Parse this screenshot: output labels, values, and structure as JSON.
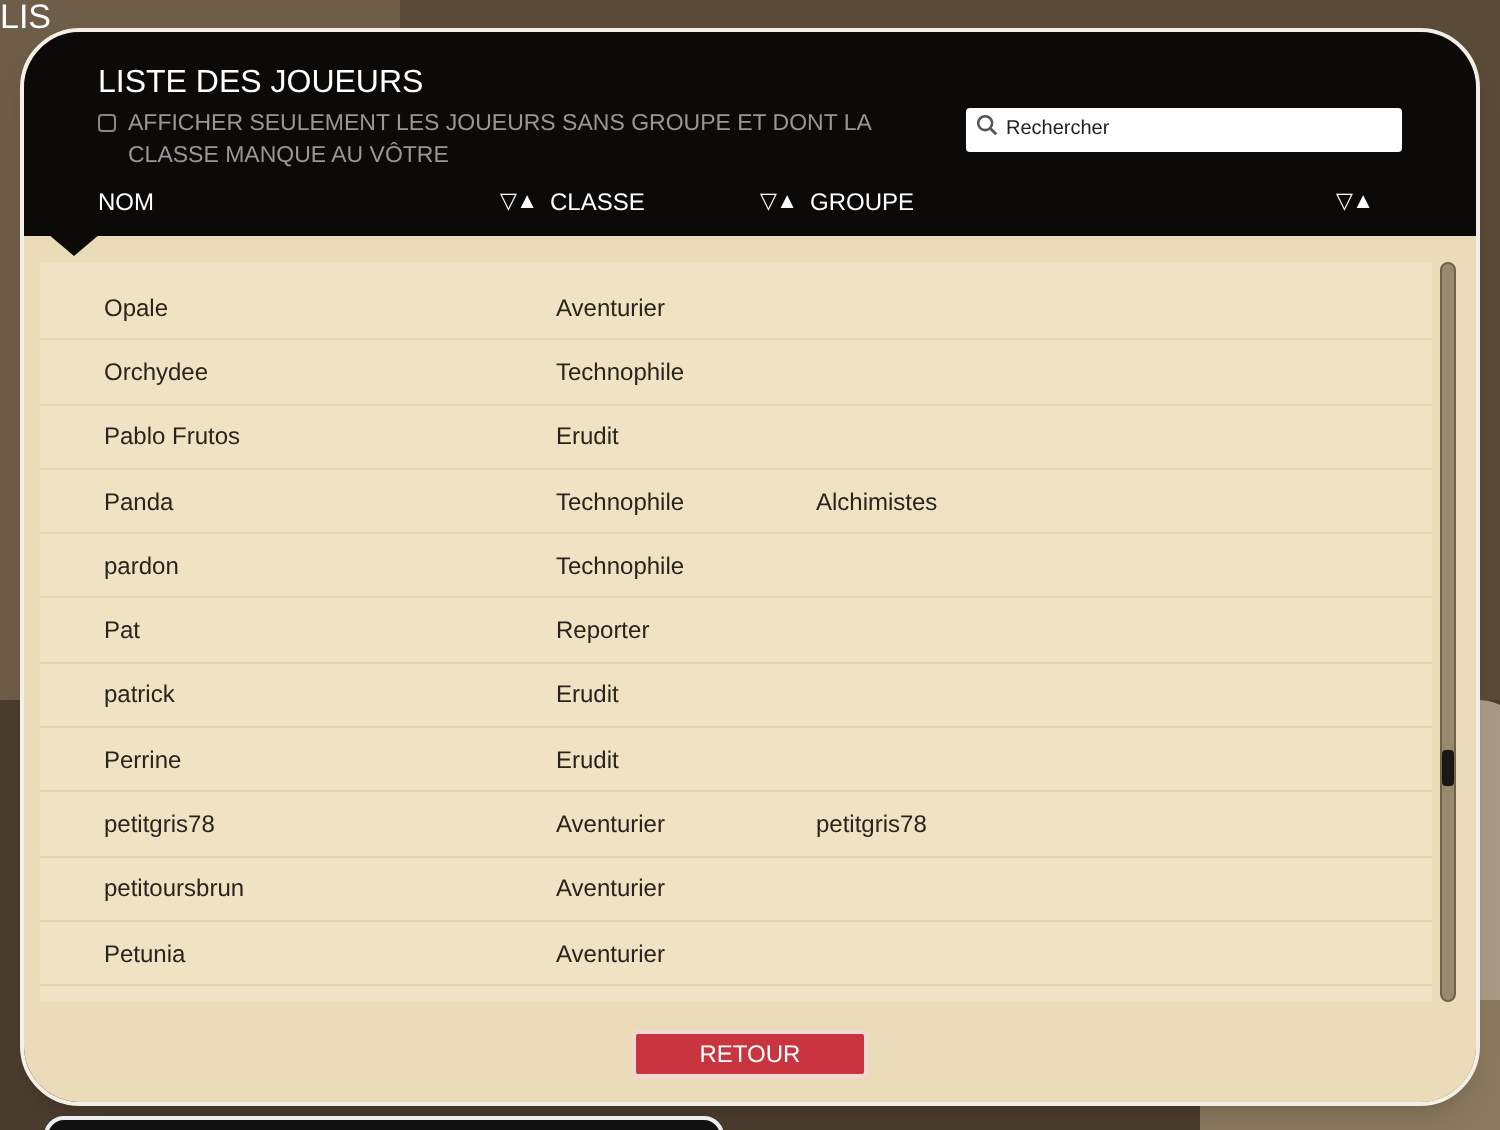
{
  "background_title": "LIS",
  "dialog": {
    "title": "LISTE DES JOUEURS",
    "filter": {
      "label": "AFFICHER SEULEMENT LES JOUEURS SANS GROUPE ET DONT LA CLASSE MANQUE AU VÔTRE",
      "checked": false
    },
    "search": {
      "placeholder": "Rechercher"
    },
    "columns": [
      {
        "label": "NOM",
        "sort": "▽▲"
      },
      {
        "label": "CLASSE",
        "sort": "▽▲"
      },
      {
        "label": "GROUPE",
        "sort": "▽▲"
      }
    ],
    "rows": [
      {
        "name": "Opale",
        "class": "Aventurier",
        "group": ""
      },
      {
        "name": "Orchydee",
        "class": "Technophile",
        "group": ""
      },
      {
        "name": "Pablo Frutos",
        "class": "Erudit",
        "group": ""
      },
      {
        "name": "Panda",
        "class": "Technophile",
        "group": "Alchimistes"
      },
      {
        "name": "pardon",
        "class": "Technophile",
        "group": ""
      },
      {
        "name": "Pat",
        "class": "Reporter",
        "group": ""
      },
      {
        "name": "patrick",
        "class": "Erudit",
        "group": ""
      },
      {
        "name": "Perrine",
        "class": "Erudit",
        "group": ""
      },
      {
        "name": "petitgris78",
        "class": "Aventurier",
        "group": "petitgris78"
      },
      {
        "name": "petitoursbrun",
        "class": "Aventurier",
        "group": ""
      },
      {
        "name": "Petunia",
        "class": "Aventurier",
        "group": ""
      }
    ],
    "back_button": "RETOUR"
  }
}
